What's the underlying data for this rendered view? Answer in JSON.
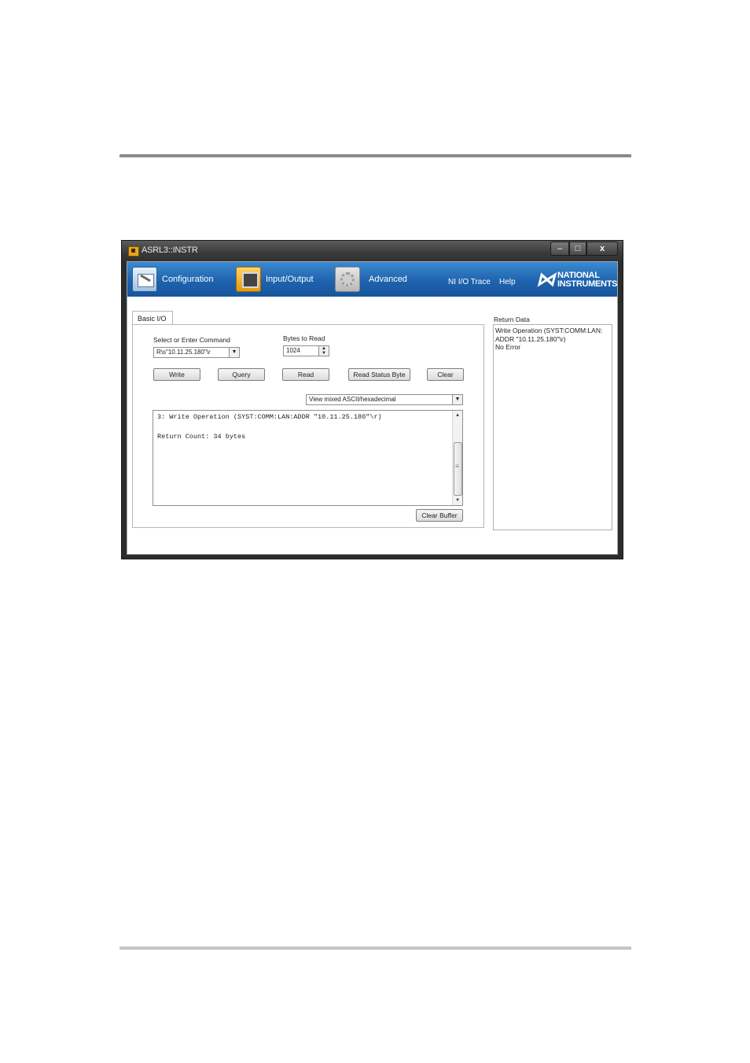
{
  "window": {
    "title": "ASRL3::INSTR",
    "controls": {
      "minimize": "–",
      "maximize": "□",
      "close": "x"
    }
  },
  "navbar": {
    "items": [
      {
        "label": "Configuration",
        "icon": "configuration-icon"
      },
      {
        "label": "Input/Output",
        "icon": "input-output-icon"
      },
      {
        "label": "Advanced",
        "icon": "advanced-gear-icon"
      }
    ],
    "links": [
      "NI I/O Trace",
      "Help"
    ],
    "logo": {
      "line1": "NATIONAL",
      "line2": "INSTRUMENTS"
    }
  },
  "tab": {
    "label": "Basic I/O"
  },
  "command": {
    "label": "Select or Enter Command",
    "value": "R\\s\"10.11.25.180\"\\r"
  },
  "bytes_to_read": {
    "label": "Bytes to Read",
    "value": "1024"
  },
  "buttons": {
    "write": "Write",
    "query": "Query",
    "read": "Read",
    "read_status_byte": "Read Status Byte",
    "clear": "Clear",
    "clear_buffer": "Clear Buffer"
  },
  "view_mode": {
    "selected": "View mixed ASCII/hexadecimal"
  },
  "output": {
    "line1": "3: Write Operation (SYST:COMM:LAN:ADDR \"10.11.25.180\"\\r)",
    "line2": "Return Count: 34 bytes"
  },
  "return_data": {
    "label": "Return Data",
    "lines": [
      "Write Operation (SYST:COMM:LAN:",
      "ADDR \"10.11.25.180\"\\r)",
      "No Error"
    ]
  }
}
